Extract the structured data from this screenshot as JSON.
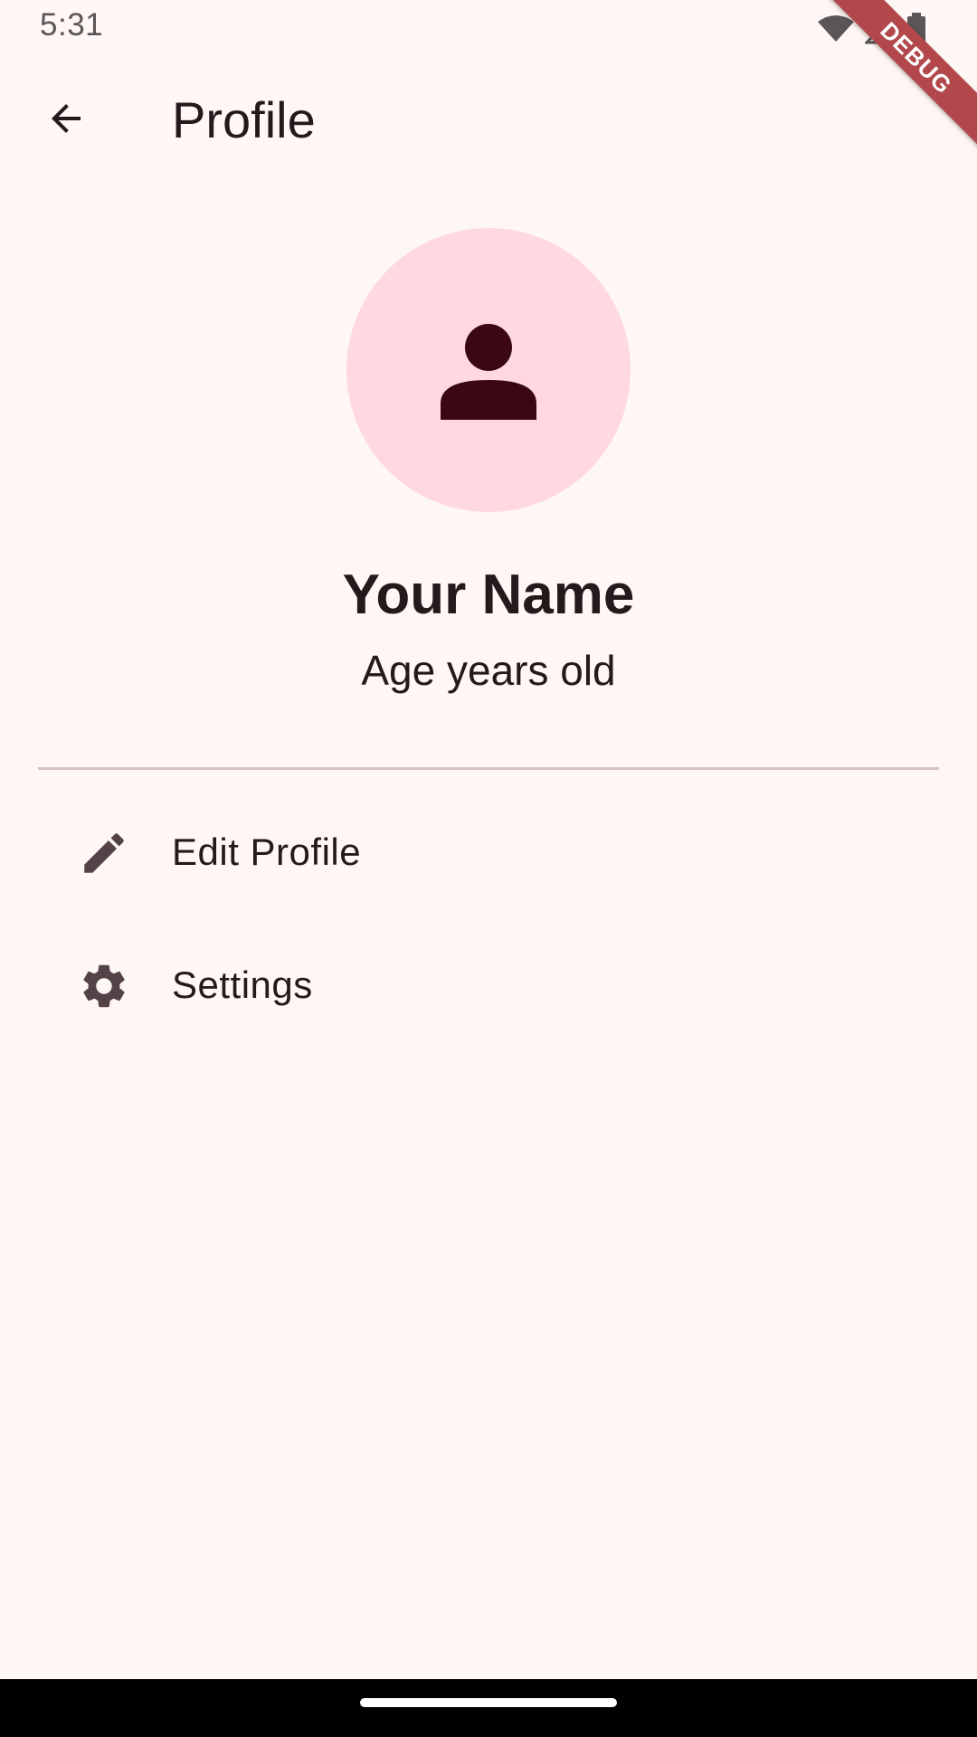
{
  "status_bar": {
    "time": "5:31",
    "icons": [
      "wifi-icon",
      "signal-icon",
      "battery-icon"
    ]
  },
  "debug_banner": "DEBUG",
  "app_bar": {
    "back_icon": "arrow-back-icon",
    "title": "Profile"
  },
  "profile": {
    "avatar_icon": "person-icon",
    "name": "Your Name",
    "age_text": "Age years old"
  },
  "menu": {
    "items": [
      {
        "icon": "edit-icon",
        "label": "Edit Profile"
      },
      {
        "icon": "settings-icon",
        "label": "Settings"
      }
    ]
  },
  "colors": {
    "background": "#fff7f6",
    "avatar_bg": "#ffd9df",
    "avatar_icon": "#3b0715",
    "text": "#231a1c",
    "icon": "#534346",
    "divider": "#d8c2c4",
    "debug_ribbon": "#b2484b"
  }
}
